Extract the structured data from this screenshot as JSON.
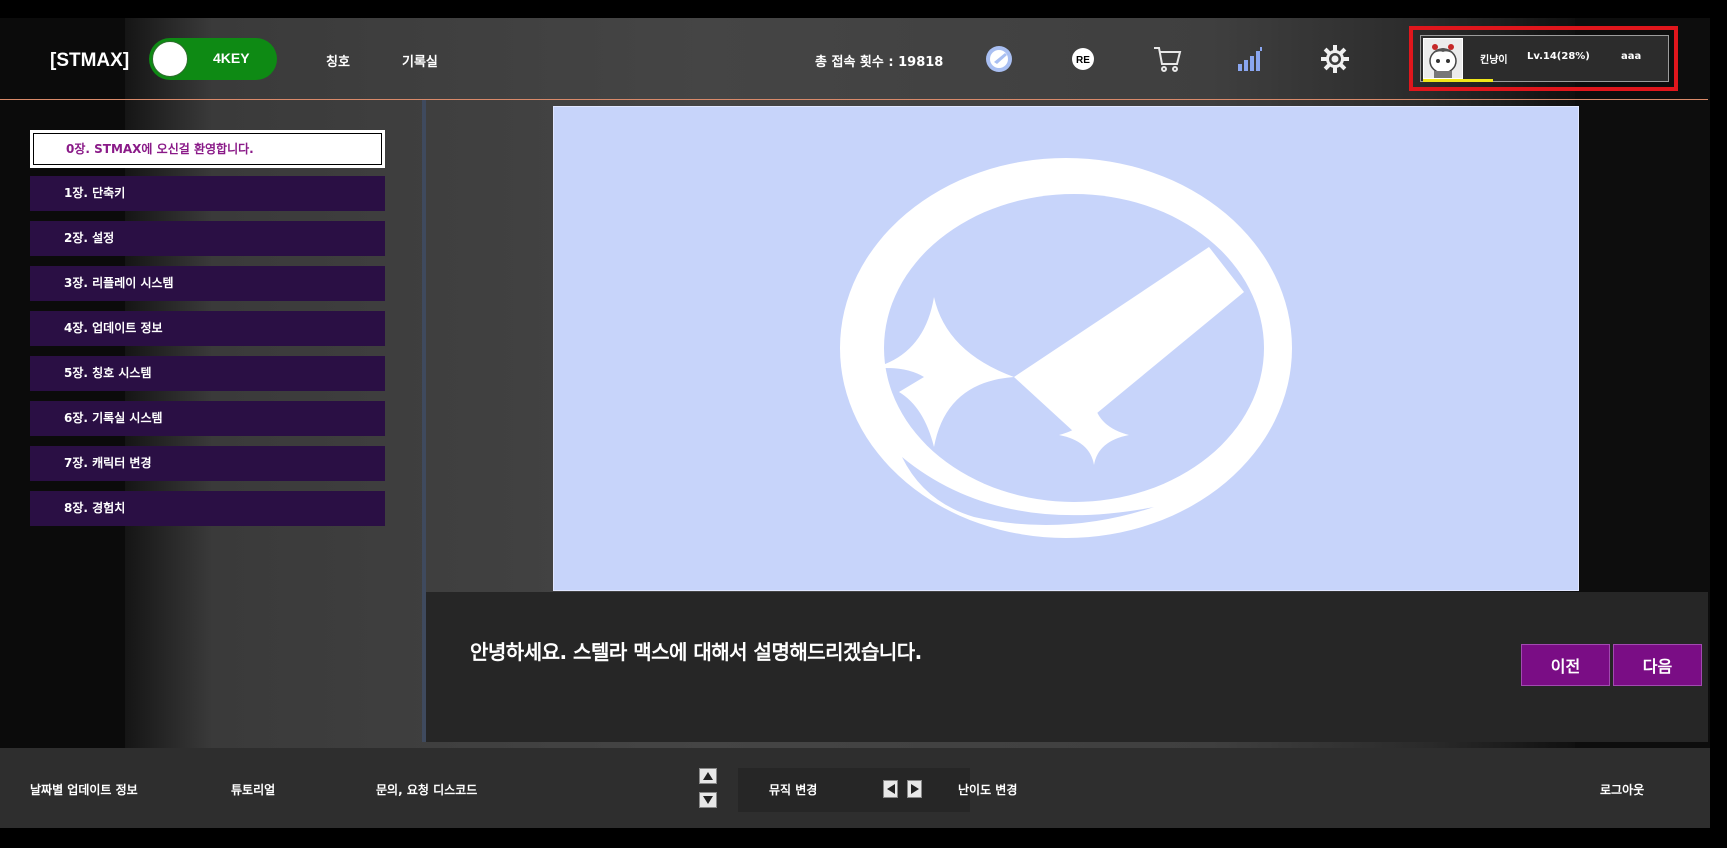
{
  "header": {
    "logo": "[STMAX]",
    "mode_toggle": "4KEY",
    "nav": [
      "칭호",
      "기록실"
    ],
    "visit_count": "총 접속 횟수 : 19818",
    "icons": [
      "stellar-logo-icon",
      "replay-icon",
      "cart-icon",
      "signal-bars-icon",
      "gear-icon"
    ],
    "profile": {
      "name": "킨냥이",
      "level": "Lv.14(28%)",
      "extra": "aaa",
      "xp_fraction": 0.28
    }
  },
  "sidebar": {
    "chapters": [
      "0장. STMAX에 오신걸 환영합니다.",
      "1장. 단축키",
      "2장. 설정",
      "3장. 리플레이 시스템",
      "4장. 업데이트 정보",
      "5장. 칭호 시스템",
      "6장. 기록실 시스템",
      "7장. 캐릭터 변경",
      "8장. 경험치"
    ],
    "active_index": 0
  },
  "dialog": {
    "text": "안녕하세요. 스텔라 맥스에 대해서 설명해드리겠습니다.",
    "prev": "이전",
    "next": "다음"
  },
  "footer": {
    "links": [
      "날짜별 업데이트 정보",
      "튜토리얼",
      "문의, 요청 디스코드"
    ],
    "music_change": "뮤직 변경",
    "difficulty_change": "난이도 변경",
    "logout": "로그아웃"
  },
  "colors": {
    "accent_purple": "#7a0d85",
    "chapter_bg": "#2a0f44",
    "toggle_green": "#0e8a14",
    "preview_bg": "#c7d4fa",
    "highlight_red": "#e0161c"
  }
}
